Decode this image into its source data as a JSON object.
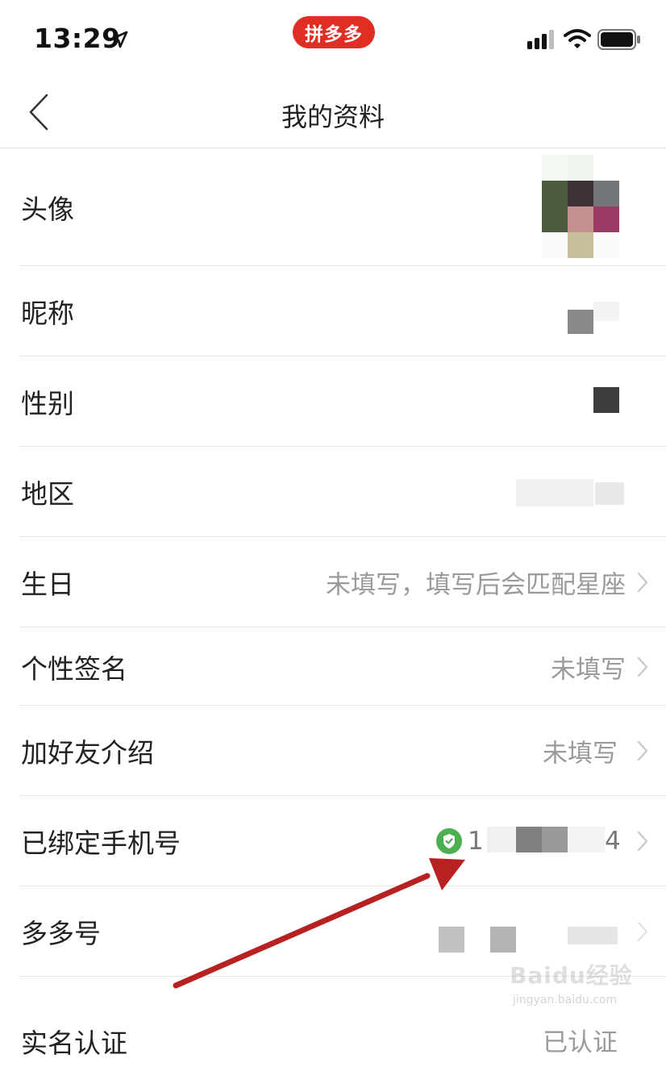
{
  "status_bar": {
    "time": "13:29",
    "app_badge": "拼多多",
    "icons": [
      "location-arrow-icon",
      "cellular-signal-icon",
      "wifi-icon",
      "battery-icon"
    ]
  },
  "nav": {
    "title": "我的资料",
    "back_icon": "chevron-left-icon"
  },
  "profile_rows": [
    {
      "label": "头像",
      "value": ""
    },
    {
      "label": "昵称",
      "value": ""
    },
    {
      "label": "性别",
      "value": ""
    },
    {
      "label": "地区",
      "value": ""
    },
    {
      "label": "生日",
      "value": "未填写，填写后会匹配星座"
    },
    {
      "label": "个性签名",
      "value": "未填写"
    },
    {
      "label": "加好友介绍",
      "value": "未填写"
    },
    {
      "label": "已绑定手机号",
      "value_start": "1",
      "value_end": "4"
    },
    {
      "label": "多多号",
      "value": ""
    },
    {
      "label": "实名认证",
      "value": "已认证"
    }
  ],
  "watermark": {
    "text": "Baidu经验",
    "sub": "jingyan.baidu.com"
  },
  "colors": {
    "brand": "#e02e24",
    "verified": "#4caf50",
    "arrow": "#b72121"
  }
}
